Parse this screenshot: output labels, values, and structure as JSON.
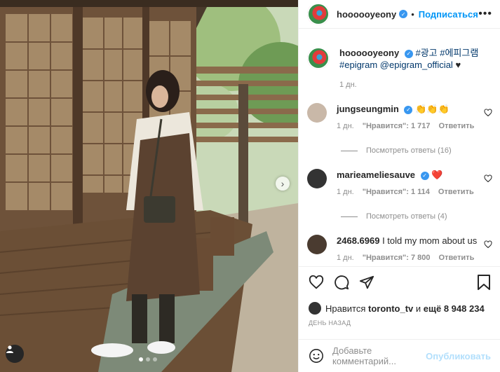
{
  "post": {
    "author": "hoooooyeony",
    "follow_label": "Подписаться",
    "separator": "•",
    "more_label": "•••",
    "caption": {
      "username": "hoooooyeony",
      "text_hashtags": "#광고 #에피그램",
      "text_line2": "#epigram @epigram_official",
      "heart": "♥",
      "time": "1 дн."
    }
  },
  "comments": [
    {
      "username": "jungseungmin",
      "text": "👏👏👏",
      "time": "1 дн.",
      "likes_label": "\"Нравится\": 1 717",
      "reply_label": "Ответить",
      "replies_label": "Посмотреть ответы (16)"
    },
    {
      "username": "marieameliesauve",
      "text": "❤️",
      "time": "1 дн.",
      "likes_label": "\"Нравится\": 1 114",
      "reply_label": "Ответить",
      "replies_label": "Посмотреть ответы (4)"
    },
    {
      "username": "2468.6969",
      "text": "I told my mom about us",
      "time": "1 дн.",
      "likes_label": "\"Нравится\": 7 800",
      "reply_label": "Ответить"
    }
  ],
  "likes": {
    "prefix": "Нравится",
    "user": "toronto_tv",
    "middle": "и",
    "suffix": "ещё 8 948 234"
  },
  "date_label": "День назад",
  "add_comment": {
    "placeholder": "Добавьте комментарий...",
    "publish_label": "Опубликовать"
  },
  "icons": {
    "more": "more-icon",
    "verified": "verified-badge-icon",
    "heart": "heart-icon",
    "comment": "comment-icon",
    "share": "share-icon",
    "bookmark": "bookmark-icon",
    "emoji": "emoji-icon",
    "next": "chevron-right-icon",
    "user_tag": "user-tag-icon"
  },
  "colors": {
    "link_blue": "#0095f6",
    "verified_blue": "#3897f0",
    "muted": "#8e8e8e",
    "publish_disabled": "#b2dffc"
  },
  "carousel": {
    "slides": 3,
    "active": 1
  }
}
